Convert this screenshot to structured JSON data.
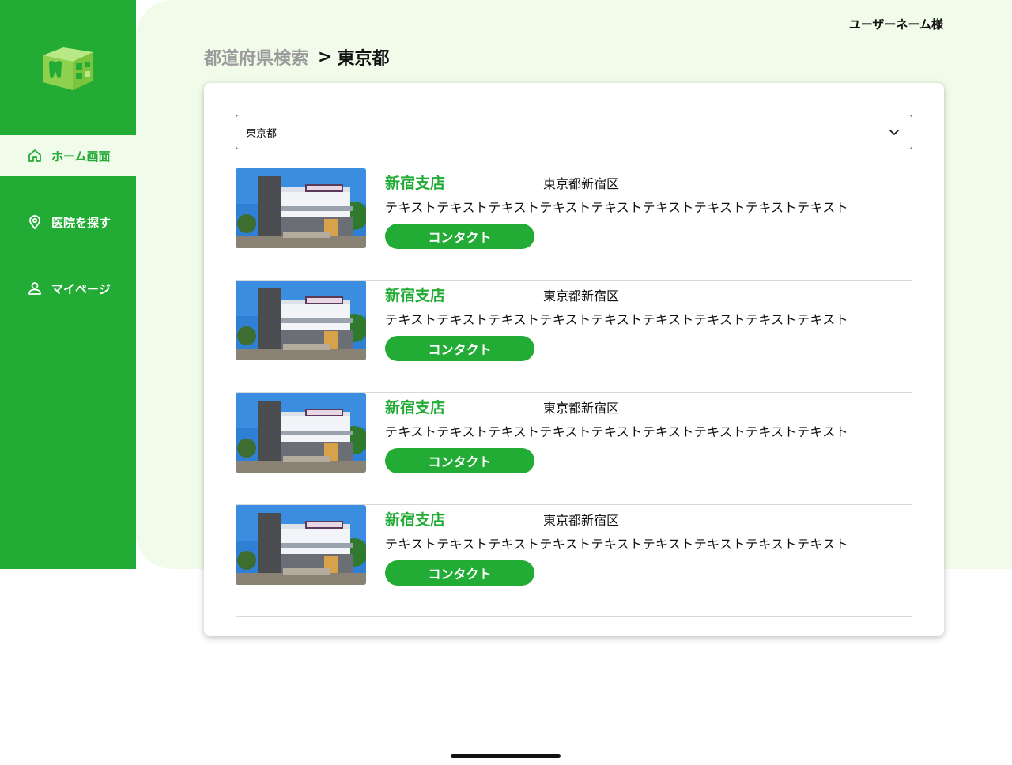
{
  "user": {
    "name": "ユーザーネーム様"
  },
  "nav": {
    "items": [
      {
        "label": "ホーム画面",
        "icon": "home-icon"
      },
      {
        "label": "医院を探す",
        "icon": "location-pin-icon"
      },
      {
        "label": "マイページ",
        "icon": "user-icon"
      }
    ],
    "active_index": 0
  },
  "breadcrumb": {
    "parent": "都道府県検索",
    "separator": ">",
    "current": "東京都"
  },
  "prefecture_select": {
    "value": "東京都"
  },
  "clinics": [
    {
      "name": "新宿支店",
      "address": "東京都新宿区",
      "description": "テキストテキストテキストテキストテキストテキストテキストテキストテキスト",
      "button": "コンタクト"
    },
    {
      "name": "新宿支店",
      "address": "東京都新宿区",
      "description": "テキストテキストテキストテキストテキストテキストテキストテキストテキスト",
      "button": "コンタクト"
    },
    {
      "name": "新宿支店",
      "address": "東京都新宿区",
      "description": "テキストテキストテキストテキストテキストテキストテキストテキストテキスト",
      "button": "コンタクト"
    },
    {
      "name": "新宿支店",
      "address": "東京都新宿区",
      "description": "テキストテキストテキストテキストテキストテキストテキストテキストテキスト",
      "button": "コンタクト"
    }
  ],
  "colors": {
    "brand": "#22ab35",
    "page_bg": "#f1fbea",
    "muted_text": "#9b9b9b"
  }
}
